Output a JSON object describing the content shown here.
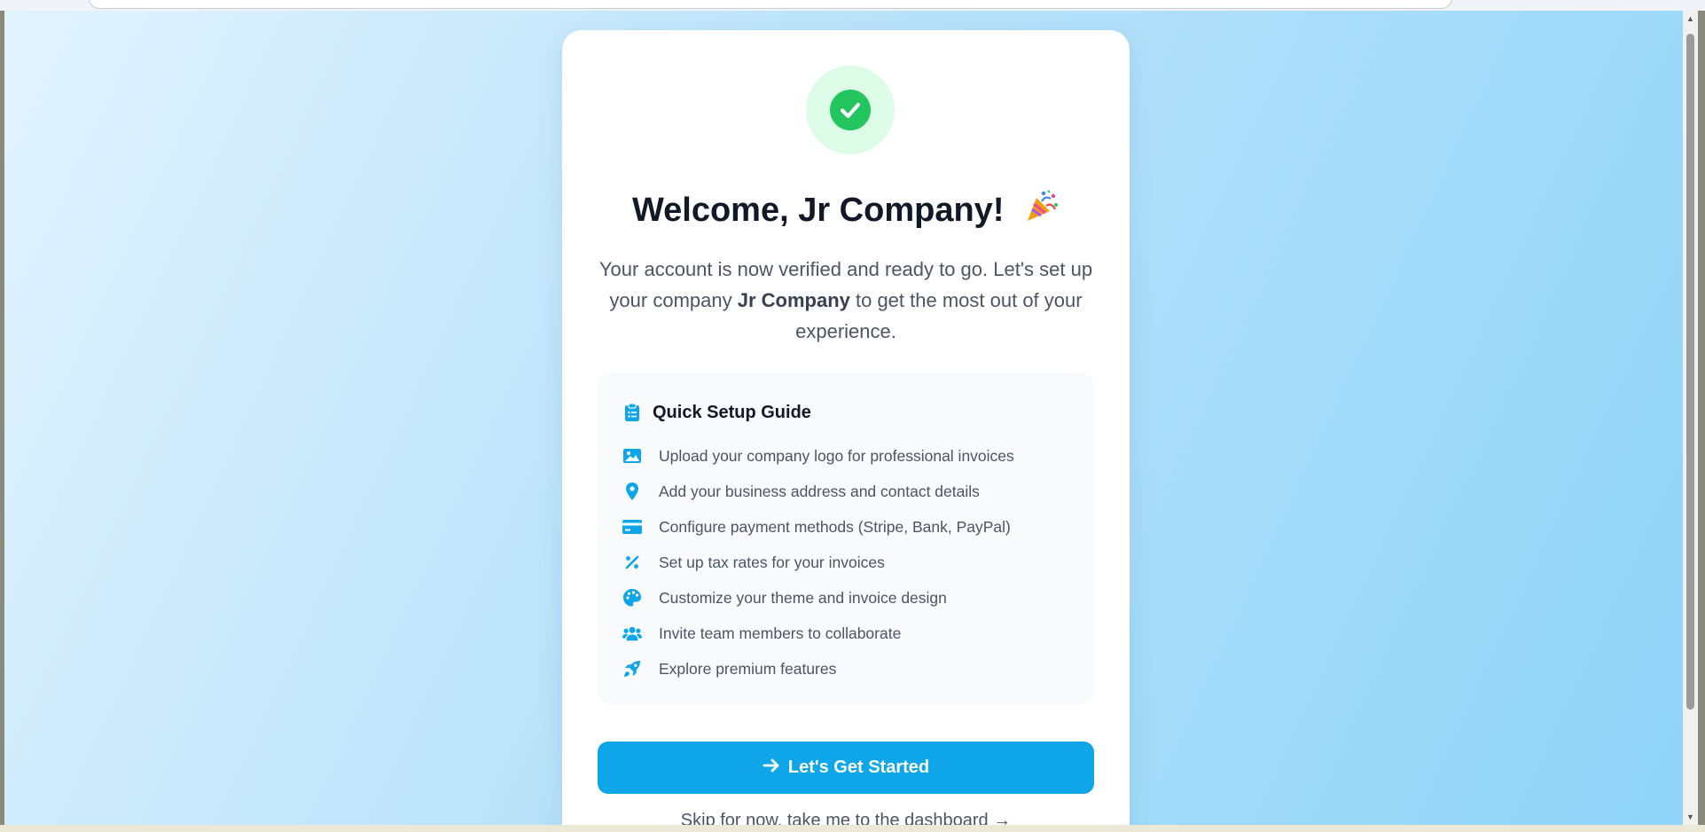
{
  "welcome": {
    "title": "Welcome, Jr Company!",
    "subtitle_part1": "Your account is now verified and ready to go. Let's set up your company ",
    "company_name": "Jr Company",
    "subtitle_part2": " to get the most out of your experience."
  },
  "guide": {
    "title": "Quick Setup Guide",
    "items": [
      {
        "icon": "image-icon",
        "label": "Upload your company logo for professional invoices"
      },
      {
        "icon": "map-pin-icon",
        "label": "Add your business address and contact details"
      },
      {
        "icon": "credit-card-icon",
        "label": "Configure payment methods (Stripe, Bank, PayPal)"
      },
      {
        "icon": "percent-icon",
        "label": "Set up tax rates for your invoices"
      },
      {
        "icon": "palette-icon",
        "label": "Customize your theme and invoice design"
      },
      {
        "icon": "users-icon",
        "label": "Invite team members to collaborate"
      },
      {
        "icon": "rocket-icon",
        "label": "Explore premium features"
      }
    ]
  },
  "actions": {
    "get_started_label": "Let's Get Started",
    "skip_label": "Skip for now, take me to the dashboard →"
  },
  "colors": {
    "accent": "#0ea5e9",
    "success": "#22c55e",
    "success_bg": "#dcfce7",
    "heading": "#111827",
    "body_text": "#4b5563"
  }
}
